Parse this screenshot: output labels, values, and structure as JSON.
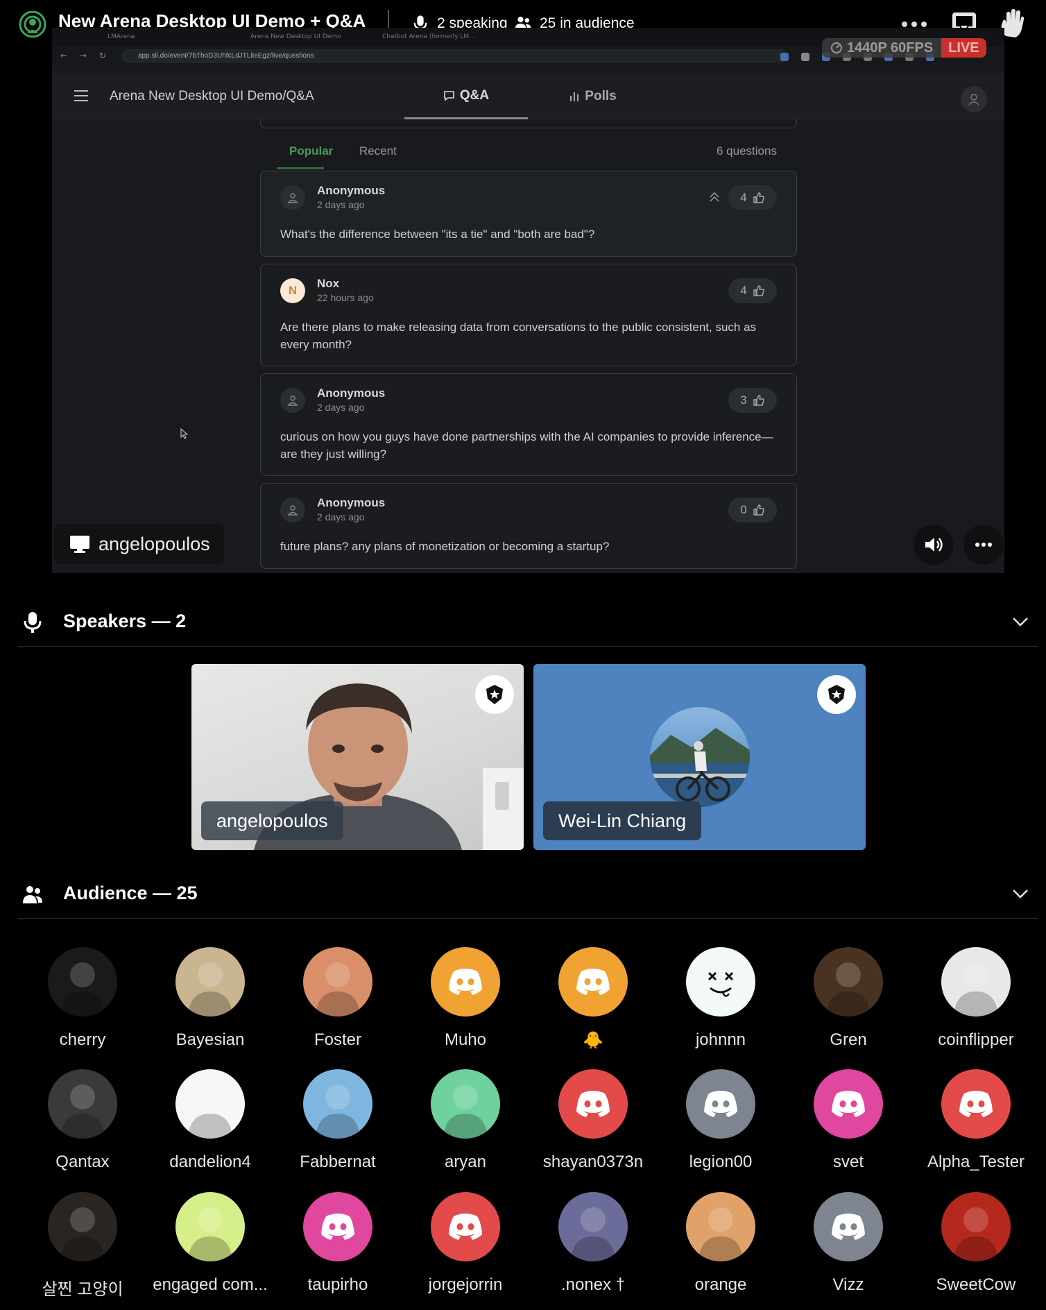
{
  "header": {
    "title": "New Arena Desktop UI Demo + Q&A",
    "speaking": "2 speaking",
    "audience": "25 in audience"
  },
  "stream": {
    "quality": "1440P 60FPS",
    "live": "LIVE",
    "browser": {
      "tabs": [
        "LMArena",
        "Arena New Desktop UI Demo",
        "Chatbot Arena (formerly LM..."
      ],
      "url": "app.sli.do/event/7bThoD3UhfcLdJTLiteEgz/live/questions"
    },
    "app_title": "Arena New Desktop UI Demo/Q&A",
    "tabs": {
      "qa": "Q&A",
      "polls": "Polls"
    },
    "subtabs": {
      "popular": "Popular",
      "recent": "Recent"
    },
    "question_count": "6 questions",
    "questions": [
      {
        "author": "Anonymous",
        "time": "2 days ago",
        "text": "What's the difference between \"its a tie\" and \"both are bad\"?",
        "votes": "4"
      },
      {
        "author": "Nox",
        "initial": "N",
        "time": "22 hours ago",
        "text": "Are there plans to make releasing data from conversations to the public consistent, such as every month?",
        "votes": "4"
      },
      {
        "author": "Anonymous",
        "time": "2 days ago",
        "text": "curious on how you guys have done partnerships with the AI companies to provide inference—are they just willing?",
        "votes": "3"
      },
      {
        "author": "Anonymous",
        "time": "2 days ago",
        "text": "future plans? any plans of monetization or becoming a startup?",
        "votes": "0"
      }
    ],
    "presenter": "angelopoulos"
  },
  "speakers": {
    "title": "Speakers — 2",
    "list": [
      {
        "name": "angelopoulos"
      },
      {
        "name": "Wei-Lin Chiang"
      }
    ]
  },
  "audience": {
    "title": "Audience — 25",
    "members": [
      {
        "name": "cherry",
        "avatar": "photo",
        "color": "#1a1a1a"
      },
      {
        "name": "Bayesian",
        "avatar": "photo",
        "color": "#c9b590"
      },
      {
        "name": "Foster",
        "avatar": "photo",
        "color": "#d88f6a"
      },
      {
        "name": "Muho",
        "avatar": "discord",
        "color": "#f0a232"
      },
      {
        "name": "🐥",
        "avatar": "discord",
        "color": "#f0a232"
      },
      {
        "name": "johnnn",
        "avatar": "face",
        "color": "#f2f9f7"
      },
      {
        "name": "Gren",
        "avatar": "photo",
        "color": "#4a3223"
      },
      {
        "name": "coinflipper",
        "avatar": "photo",
        "color": "#e8e8e8"
      },
      {
        "name": "Qantax",
        "avatar": "photo",
        "color": "#3a3a3a"
      },
      {
        "name": "dandelion4",
        "avatar": "photo",
        "color": "#f6f6f6"
      },
      {
        "name": "Fabbernat",
        "avatar": "photo",
        "color": "#7fb6e0"
      },
      {
        "name": "aryan",
        "avatar": "photo",
        "color": "#6fd19e"
      },
      {
        "name": "shayan0373n",
        "avatar": "discord",
        "color": "#e34b4b"
      },
      {
        "name": "legion00",
        "avatar": "discord",
        "color": "#7e8590"
      },
      {
        "name": "svet",
        "avatar": "discord",
        "color": "#e0479e"
      },
      {
        "name": "Alpha_Tester",
        "avatar": "discord",
        "color": "#e34b4b"
      },
      {
        "name": "살찐 고양이",
        "avatar": "photo",
        "color": "#2b2522"
      },
      {
        "name": "engaged com...",
        "avatar": "photo",
        "color": "#d7ef8a"
      },
      {
        "name": "taupirho",
        "avatar": "discord",
        "color": "#e0479e"
      },
      {
        "name": "jorgejorrin",
        "avatar": "discord",
        "color": "#e34b4b"
      },
      {
        "name": ".nonex †",
        "avatar": "photo",
        "color": "#6c6c9a"
      },
      {
        "name": "orange",
        "avatar": "photo",
        "color": "#e1a26a"
      },
      {
        "name": "Vizz",
        "avatar": "discord",
        "color": "#7e8590"
      },
      {
        "name": "SweetCow",
        "avatar": "photo",
        "color": "#b5281e"
      }
    ]
  }
}
